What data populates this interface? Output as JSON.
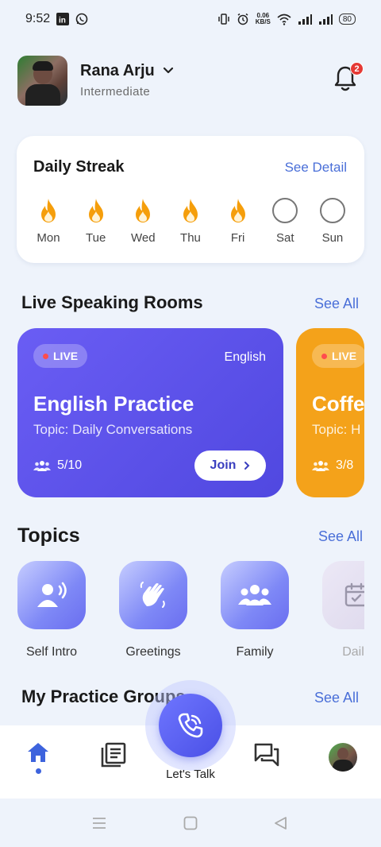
{
  "status_bar": {
    "time": "9:52",
    "speed_value": "0.06",
    "speed_unit": "KB/S",
    "battery": "80"
  },
  "user": {
    "name": "Rana Arju",
    "level": "Intermediate",
    "notification_count": "2"
  },
  "streak": {
    "title": "Daily Streak",
    "see_detail": "See Detail",
    "days": [
      {
        "label": "Mon",
        "done": true
      },
      {
        "label": "Tue",
        "done": true
      },
      {
        "label": "Wed",
        "done": true
      },
      {
        "label": "Thu",
        "done": true
      },
      {
        "label": "Fri",
        "done": true
      },
      {
        "label": "Sat",
        "done": false
      },
      {
        "label": "Sun",
        "done": false
      }
    ]
  },
  "rooms_section": {
    "title": "Live Speaking Rooms",
    "see_all": "See All",
    "rooms": [
      {
        "live": "LIVE",
        "language": "English",
        "title": "English Practice",
        "topic": "Topic: Daily Conversations",
        "count": "5/10",
        "join": "Join"
      },
      {
        "live": "LIVE",
        "title": "Coffe",
        "topic": "Topic: H",
        "count": "3/8"
      }
    ]
  },
  "topics_section": {
    "title": "Topics",
    "see_all": "See All",
    "items": [
      {
        "label": "Self Intro",
        "icon": "speaker-person-icon"
      },
      {
        "label": "Greetings",
        "icon": "waving-hand-icon"
      },
      {
        "label": "Family",
        "icon": "group-icon"
      },
      {
        "label": "Daily",
        "icon": "calendar-icon"
      }
    ]
  },
  "groups_section": {
    "title": "My Practice Groups",
    "see_all": "See All"
  },
  "bottom_nav": {
    "fab_label": "Let's Talk",
    "items": [
      "home-icon",
      "library-icon",
      "call-icon",
      "chat-icon",
      "profile-avatar"
    ]
  },
  "colors": {
    "accent": "#4a6fd8",
    "room_purple": "#5a52ea",
    "room_orange": "#f4a21a",
    "streak_flame": "#f59e0b"
  }
}
